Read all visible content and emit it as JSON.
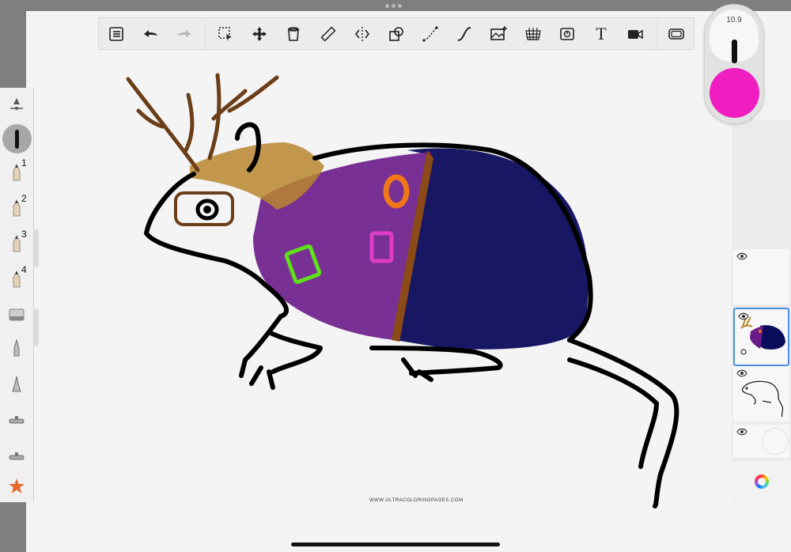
{
  "toolbar": {
    "tools": [
      {
        "name": "menu-list-icon"
      },
      {
        "name": "undo-icon"
      },
      {
        "name": "redo-icon"
      },
      {
        "name": "selection-icon"
      },
      {
        "name": "transform-icon"
      },
      {
        "name": "fill-icon"
      },
      {
        "name": "ruler-icon"
      },
      {
        "name": "symmetry-icon"
      },
      {
        "name": "shape-icon"
      },
      {
        "name": "curve-icon"
      },
      {
        "name": "stroke-icon"
      },
      {
        "name": "image-icon"
      },
      {
        "name": "perspective-icon"
      },
      {
        "name": "flipbook-icon"
      },
      {
        "name": "text-icon"
      },
      {
        "name": "video-icon"
      },
      {
        "name": "fullscreen-icon"
      }
    ],
    "text_tool_label": "T"
  },
  "brush_puck": {
    "size_value": "10.9",
    "color": "#f01ec0"
  },
  "left_palette": {
    "presets": [
      {
        "label": "1"
      },
      {
        "label": "2"
      },
      {
        "label": "3"
      },
      {
        "label": "4"
      }
    ]
  },
  "layers": [
    {
      "name": "empty-layer",
      "visible": true
    },
    {
      "name": "coloring-layer",
      "visible": true,
      "selected": true
    },
    {
      "name": "line-art-layer",
      "visible": true
    },
    {
      "name": "background-layer",
      "visible": true
    }
  ],
  "layer_panel": {
    "add_label": "+"
  },
  "canvas": {
    "watermark": "WWW.ULTRACOLORINGPAGES.COM",
    "colors": {
      "outline": "#000000",
      "antlers": "#6b3e1a",
      "hair": "#b8862f",
      "sweater": "#6a1b8a",
      "body": "#0b0b5c",
      "accent_orange": "#f07818",
      "accent_green": "#5fe01a",
      "accent_pink": "#e03cc8",
      "stripe_brown": "#8b4a17"
    }
  }
}
